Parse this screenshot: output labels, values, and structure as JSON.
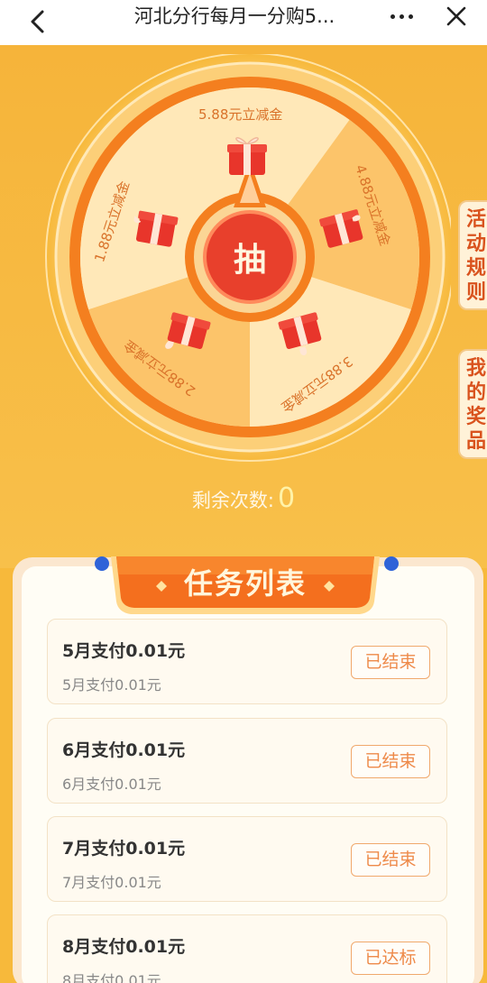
{
  "nav": {
    "title": "河北分行每月一分购5...",
    "back_icon": "chevron-left-icon",
    "more_icon": "more-dots-icon",
    "close_icon": "close-icon"
  },
  "wheel": {
    "center_label": "抽",
    "prizes": [
      {
        "label": "5.88元立减金"
      },
      {
        "label": "4.88元立减金"
      },
      {
        "label": "3.88元立减金"
      },
      {
        "label": "2.88元立减金"
      },
      {
        "label": "1.88元立减金"
      }
    ],
    "colors": {
      "light": "#ffe8b8",
      "dark": "#fcc46a",
      "rim": "#f47f1f",
      "center": "#e8402c"
    }
  },
  "side_tabs": {
    "rules": "活动规则",
    "my_prizes": "我的奖品"
  },
  "remaining": {
    "label": "剩余次数:",
    "count": "0"
  },
  "tasks_panel": {
    "title": "任务列表",
    "tasks": [
      {
        "title": "5月支付0.01元",
        "subtitle": "5月支付0.01元",
        "status": "已结束"
      },
      {
        "title": "6月支付0.01元",
        "subtitle": "6月支付0.01元",
        "status": "已结束"
      },
      {
        "title": "7月支付0.01元",
        "subtitle": "7月支付0.01元",
        "status": "已结束"
      },
      {
        "title": "8月支付0.01元",
        "subtitle": "8月支付0.01元",
        "status": "已达标"
      }
    ]
  }
}
